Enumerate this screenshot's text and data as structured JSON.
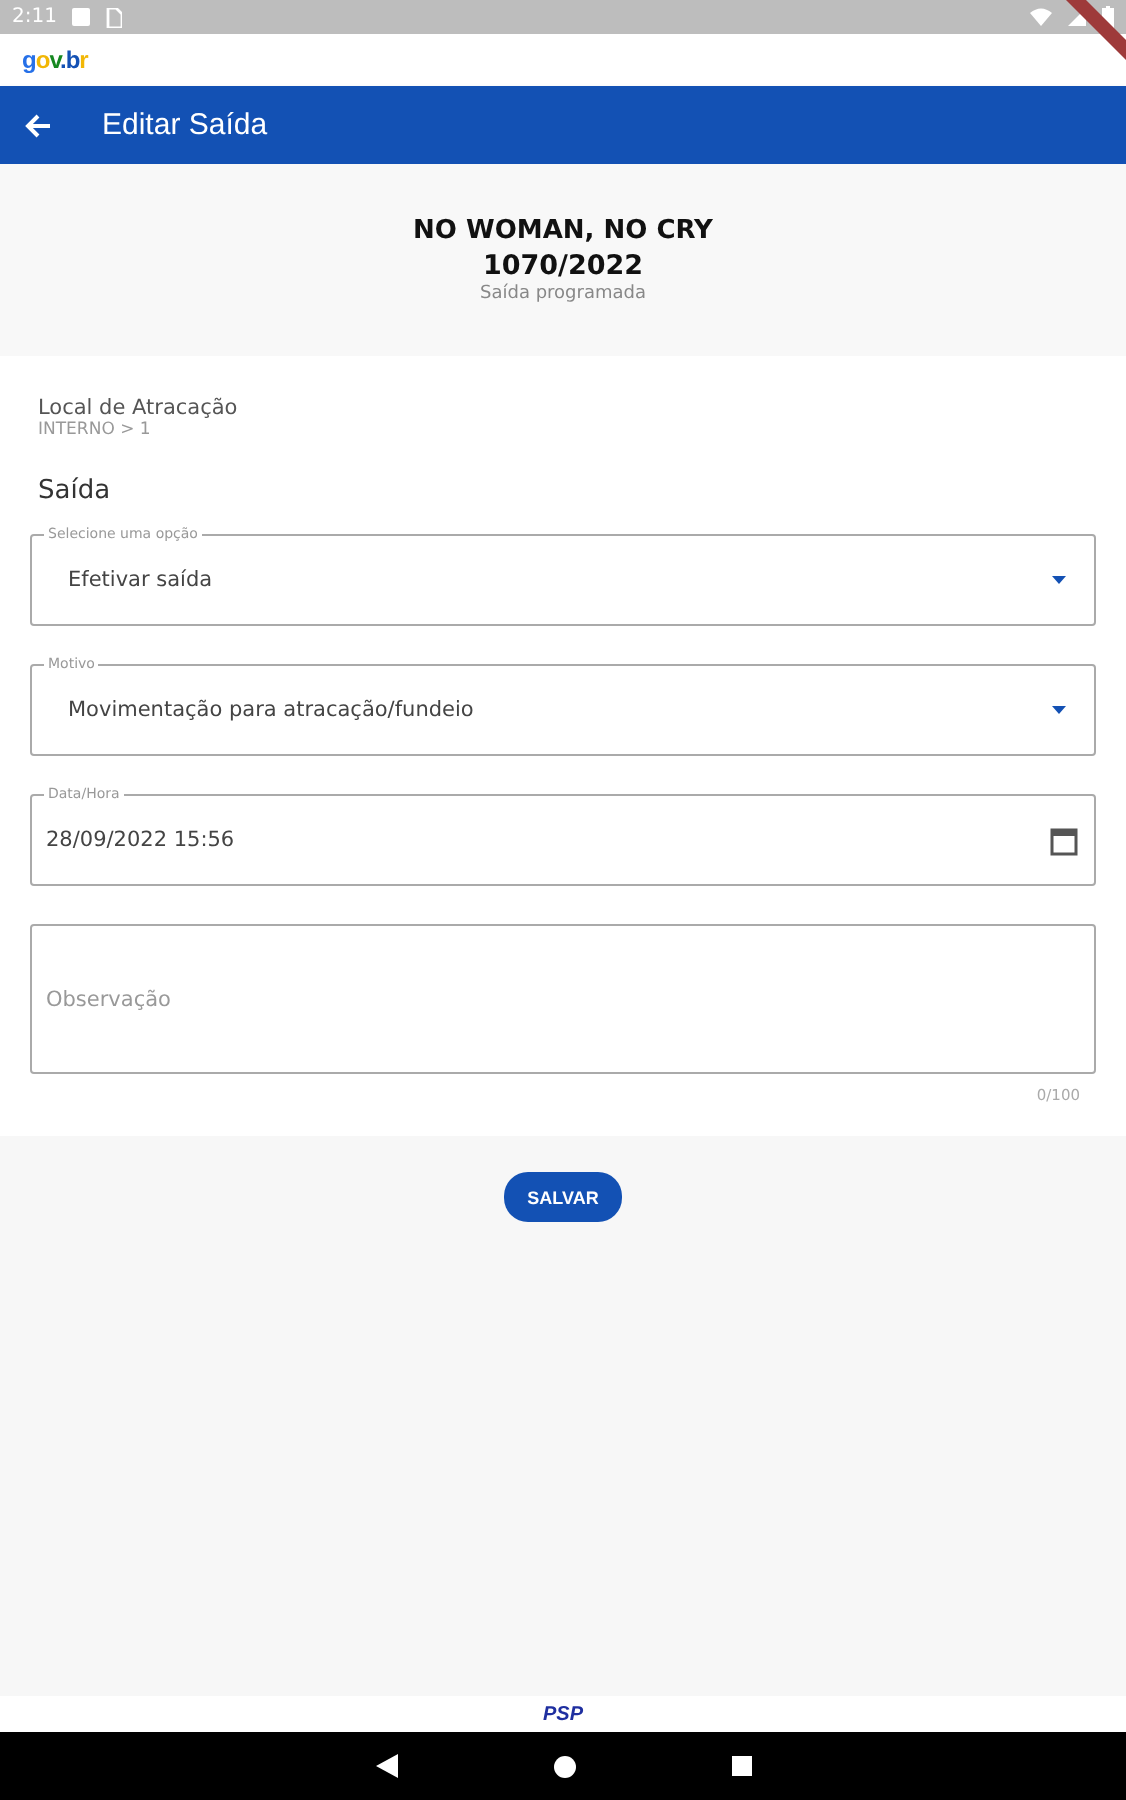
{
  "status_bar": {
    "time": "2:11"
  },
  "brand": {
    "letters": [
      {
        "text": "g",
        "color": "#2670e8"
      },
      {
        "text": "o",
        "color": "#f2b705"
      },
      {
        "text": "v",
        "color": "#168821"
      },
      {
        "text": ".",
        "color": "#1351b4"
      },
      {
        "text": "b",
        "color": "#1351b4"
      },
      {
        "text": "r",
        "color": "#f2b705"
      }
    ]
  },
  "app_bar": {
    "title": "Editar Saída"
  },
  "header": {
    "name": "NO WOMAN, NO CRY",
    "number": "1070/2022",
    "status": "Saída programada"
  },
  "location": {
    "label": "Local de Atracação",
    "value": "INTERNO > 1"
  },
  "section_title": "Saída",
  "fields": [
    {
      "kind": "select",
      "label": "Selecione uma opção",
      "value": "Efetivar saída"
    },
    {
      "kind": "select",
      "label": "Motivo",
      "value": "Movimentação para atracação/fundeio"
    },
    {
      "kind": "date",
      "label": "Data/Hora",
      "value": "28/09/2022 15:56"
    },
    {
      "kind": "textarea",
      "placeholder": "Observação",
      "counter": "0/100"
    }
  ],
  "save_button": "SALVAR",
  "footer": {
    "logo": "PSP"
  }
}
